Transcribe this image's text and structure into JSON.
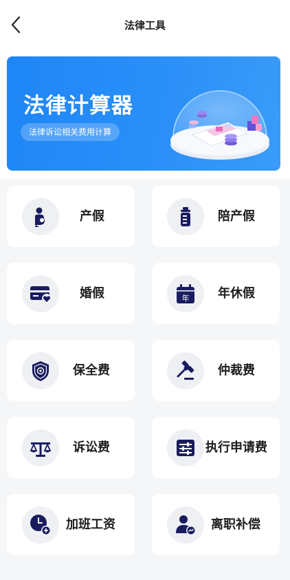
{
  "header": {
    "title": "法律工具"
  },
  "banner": {
    "title": "法律计算器",
    "subtitle": "法律诉讼相关费用计算"
  },
  "tools": [
    {
      "label": "产假",
      "icon": "maternity-icon"
    },
    {
      "label": "陪产假",
      "icon": "baby-bottle-icon"
    },
    {
      "label": "婚假",
      "icon": "marriage-card-icon"
    },
    {
      "label": "年休假",
      "icon": "calendar-icon",
      "icon_text": "年"
    },
    {
      "label": "保全费",
      "icon": "shield-icon"
    },
    {
      "label": "仲裁费",
      "icon": "gavel-icon"
    },
    {
      "label": "诉讼费",
      "icon": "scales-icon"
    },
    {
      "label": "执行申请费",
      "icon": "sliders-icon"
    },
    {
      "label": "加班工资",
      "icon": "overtime-clock-icon"
    },
    {
      "label": "离职补偿",
      "icon": "resignation-user-icon"
    }
  ],
  "colors": {
    "accent": "#1e86f6",
    "icon": "#1a1c5e",
    "card": "#ffffff",
    "background": "#f5f6f8"
  }
}
